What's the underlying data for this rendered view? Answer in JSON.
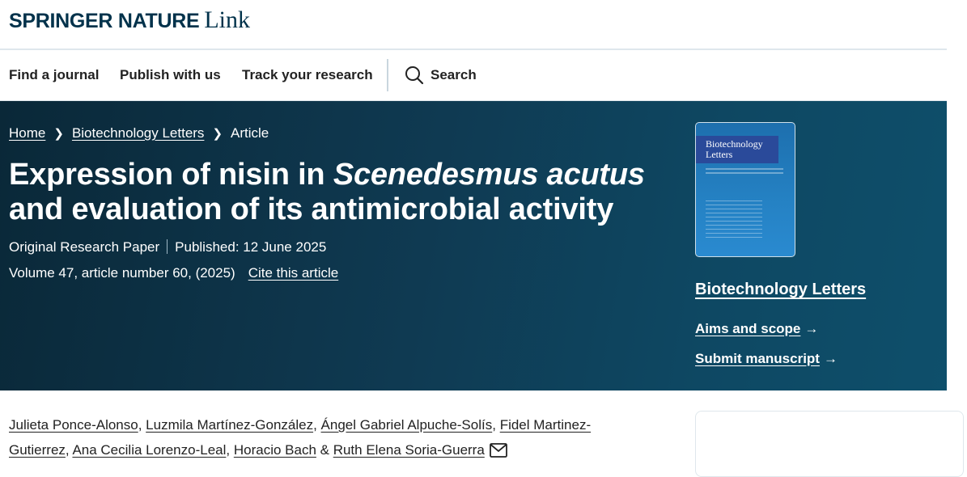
{
  "brand": {
    "name": "SPRINGER NATURE",
    "product": "Link"
  },
  "nav": {
    "items": [
      "Find a journal",
      "Publish with us",
      "Track your research"
    ],
    "search_label": "Search"
  },
  "breadcrumb": {
    "home": "Home",
    "journal": "Biotechnology Letters",
    "current": "Article"
  },
  "article": {
    "title_part1": "Expression of nisin in ",
    "title_italic": "Scenedesmus acutus",
    "title_part2": "and evaluation of its antimicrobial activity",
    "type": "Original Research Paper",
    "published": "Published: 12 June 2025",
    "volume": "Volume 47, article number 60, (2025)",
    "cite_label": "Cite this article"
  },
  "journal": {
    "cover_title": "Biotechnology Letters",
    "name": "Biotechnology Letters",
    "aims_label": "Aims and scope",
    "submit_label": "Submit manuscript"
  },
  "authors": {
    "list": [
      "Julieta Ponce-Alonso",
      "Luzmila Martínez-González",
      "Ángel Gabriel Alpuche-Solís",
      "Fidel Martinez-Gutierrez",
      "Ana Cecilia Lorenzo-Leal",
      "Horacio Bach",
      "Ruth Elena Soria-Guerra"
    ],
    "sep": ", ",
    "amp": " & "
  },
  "icons": {
    "search": "search-icon",
    "arrow": "arrow-right-icon",
    "mail": "envelope-icon"
  },
  "colors": {
    "brand_navy": "#01324b",
    "hero_start": "#0a2838",
    "hero_end": "#0e4f6b"
  }
}
